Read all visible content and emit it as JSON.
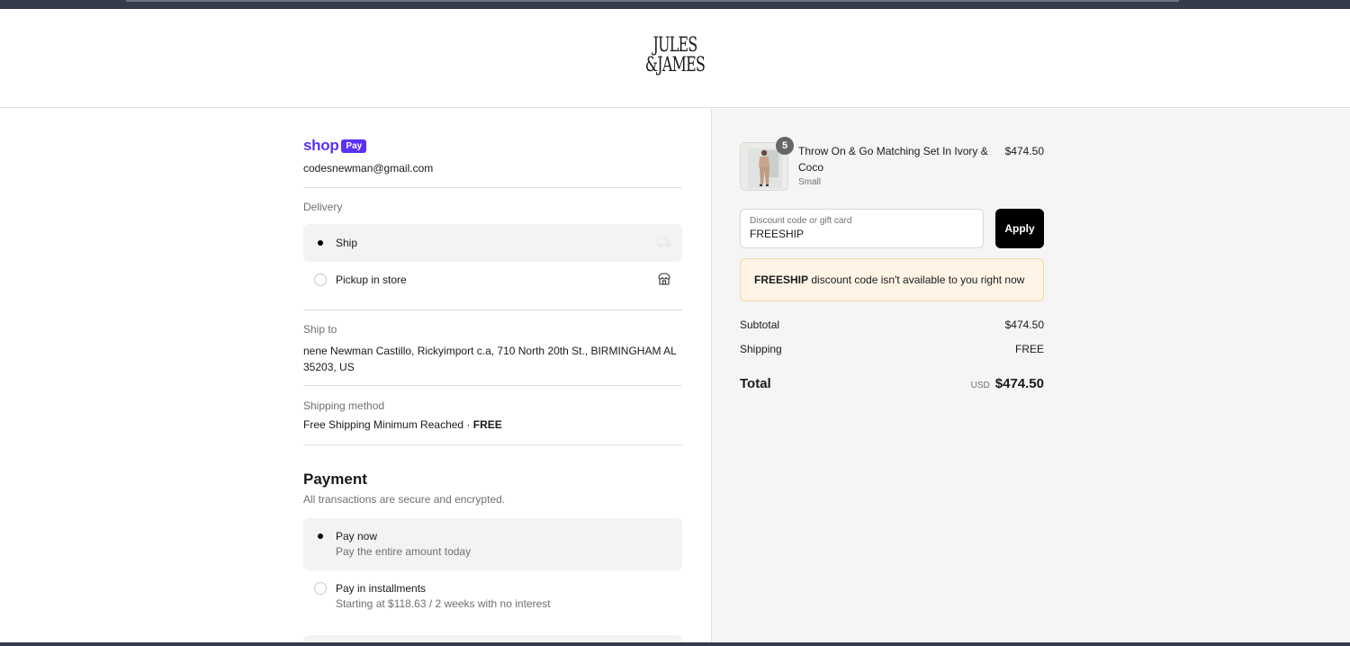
{
  "brand": {
    "logo_line1": "JULES",
    "logo_line2": "&JAMES"
  },
  "shop_pay": {
    "word": "shop",
    "badge": "Pay"
  },
  "contact": {
    "email": "codesnewman@gmail.com"
  },
  "delivery": {
    "label": "Delivery",
    "options": [
      {
        "label": "Ship",
        "selected": true
      },
      {
        "label": "Pickup in store",
        "selected": false
      }
    ]
  },
  "ship_to": {
    "label": "Ship to",
    "address": "nene Newman Castillo, Rickyimport c.a, 710 North 20th St., BIRMINGHAM AL 35203, US"
  },
  "shipping_method": {
    "label": "Shipping method",
    "name": "Free Shipping Minimum Reached",
    "separator": " · ",
    "price": "FREE"
  },
  "payment": {
    "title": "Payment",
    "subtitle": "All transactions are secure and encrypted.",
    "options": [
      {
        "title": "Pay now",
        "description": "Pay the entire amount today",
        "selected": true
      },
      {
        "title": "Pay in installments",
        "description": "Starting at $118.63 / 2 weeks with no interest",
        "selected": false
      }
    ]
  },
  "order": {
    "item": {
      "quantity": "5",
      "name": "Throw On & Go Matching Set In Ivory & Coco",
      "variant": "Small",
      "price": "$474.50"
    },
    "discount": {
      "placeholder": "Discount code or gift card",
      "value": "FREESHIP",
      "apply_label": "Apply",
      "notice_code": "FREESHIP",
      "notice_text": " discount code isn't available to you right now"
    },
    "subtotal_label": "Subtotal",
    "subtotal_value": "$474.50",
    "shipping_label": "Shipping",
    "shipping_value": "FREE",
    "total_label": "Total",
    "currency": "USD",
    "total_value": "$474.50"
  },
  "colors": {
    "shop_pay_purple": "#5a31f4",
    "notice_bg": "#fff4e6",
    "summary_bg": "#f5f5f5",
    "button_black": "#000000"
  }
}
